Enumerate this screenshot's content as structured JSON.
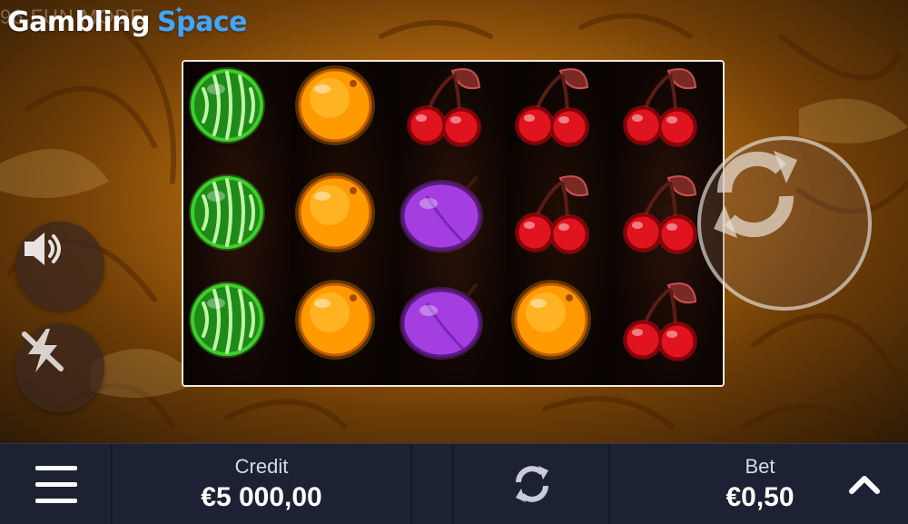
{
  "header": {
    "logo_word1": "Gambling",
    "logo_word2": "Space",
    "mode_text": "96  FUN MODE"
  },
  "reels": [
    [
      "watermelon-icon",
      "watermelon-icon",
      "watermelon-icon"
    ],
    [
      "orange-icon",
      "orange-icon",
      "orange-icon"
    ],
    [
      "cherry-icon",
      "plum-icon",
      "plum-icon"
    ],
    [
      "cherry-icon",
      "cherry-icon",
      "orange-icon"
    ],
    [
      "cherry-icon",
      "cherry-icon",
      "cherry-icon"
    ]
  ],
  "controls": {
    "sound_icon": "speaker-icon",
    "turbo_icon": "turbo-off-icon",
    "spin_icon": "spin-arrows-icon",
    "menu_icon": "hamburger-menu-icon",
    "autoplay_icon": "autoplay-arrows-icon",
    "bet_up_icon": "chevron-up-icon"
  },
  "footer": {
    "credit_label": "Credit",
    "credit_value": "€5 000,00",
    "bet_label": "Bet",
    "bet_value": "€0,50"
  },
  "colors": {
    "accent_blue": "#3fa6ff",
    "footer_bg": "#1c2233",
    "cherry_red": "#e0141e",
    "plum_purple": "#a53ee0",
    "orange": "#ff9a00",
    "melon_green": "#3bd02a"
  }
}
